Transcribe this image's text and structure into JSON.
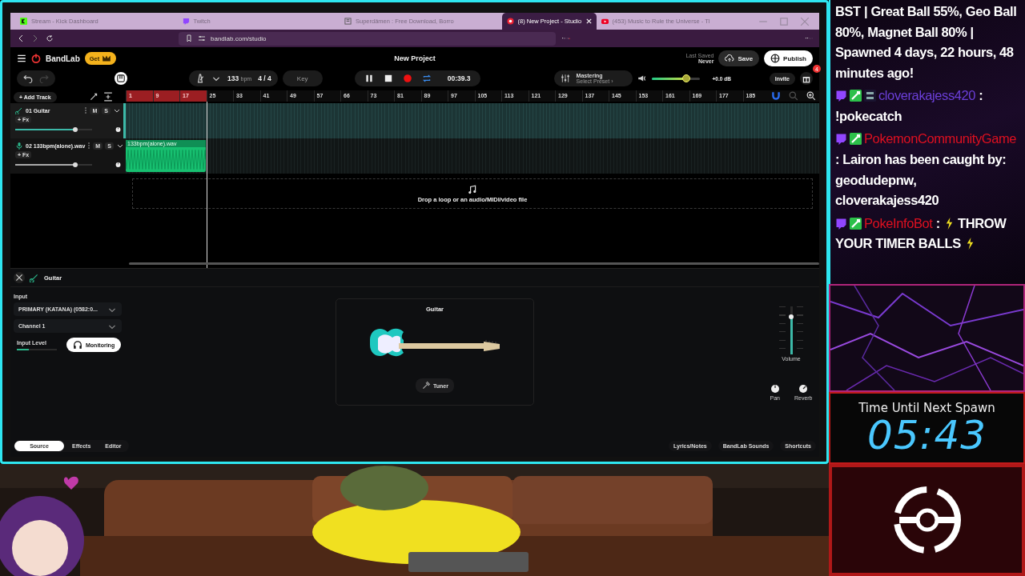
{
  "browser": {
    "tabs": [
      {
        "title": "Stream - Kick Dashboard",
        "selected": false
      },
      {
        "title": "Twitch",
        "selected": false
      },
      {
        "title": "Superdämen : Free Download, Borro",
        "selected": false
      },
      {
        "title": "(8) New Project - Studio",
        "selected": true
      },
      {
        "title": "(453) Music to Rule the Universe - Tl",
        "selected": false
      }
    ],
    "address": "bandlab.com/studio"
  },
  "app": {
    "logo": "BandLab",
    "get_button": "Get",
    "project_title": "New Project",
    "last_saved_label": "Last Saved",
    "last_saved_value": "Never",
    "save": "Save",
    "publish": "Publish",
    "tempo": "133",
    "tempo_unit": "bpm",
    "time_signature": "4 / 4",
    "key": "Key",
    "playing": true,
    "time": "00:39.3",
    "loop_on": true,
    "mastering": {
      "title": "Mastering",
      "preset": "Select Preset ›"
    },
    "master_volume": {
      "level": 0.72
    },
    "gain": "+0.0 dB",
    "invite": "Invite",
    "gift_badge": "4",
    "add_track": "+ Add Track",
    "ruler": [
      {
        "label": "1",
        "in_loop": true
      },
      {
        "label": "9",
        "in_loop": true
      },
      {
        "label": "17",
        "in_loop": true
      },
      {
        "label": "25",
        "in_loop": false
      },
      {
        "label": "33",
        "in_loop": false
      },
      {
        "label": "41",
        "in_loop": false
      },
      {
        "label": "49",
        "in_loop": false
      },
      {
        "label": "57",
        "in_loop": false
      },
      {
        "label": "66",
        "in_loop": false
      },
      {
        "label": "73",
        "in_loop": false
      },
      {
        "label": "81",
        "in_loop": false
      },
      {
        "label": "89",
        "in_loop": false
      },
      {
        "label": "97",
        "in_loop": false
      },
      {
        "label": "105",
        "in_loop": false
      },
      {
        "label": "113",
        "in_loop": false
      },
      {
        "label": "121",
        "in_loop": false
      },
      {
        "label": "129",
        "in_loop": false
      },
      {
        "label": "137",
        "in_loop": false
      },
      {
        "label": "145",
        "in_loop": false
      },
      {
        "label": "153",
        "in_loop": false
      },
      {
        "label": "161",
        "in_loop": false
      },
      {
        "label": "169",
        "in_loop": false
      },
      {
        "label": "177",
        "in_loop": false
      },
      {
        "label": "185",
        "in_loop": false
      }
    ],
    "tracks": [
      {
        "number": "01",
        "name": "Guitar",
        "kind": "instrument",
        "selected": true,
        "fx": "+ Fx",
        "mute": "M",
        "solo": "S",
        "volume": {
          "level": 0.78
        }
      },
      {
        "number": "02",
        "name": "133bpm(alone).wav",
        "kind": "audio",
        "selected": false,
        "fx": "+ Fx",
        "mute": "M",
        "solo": "S",
        "volume": {
          "level": 0.78
        },
        "clip": "133bpm(alone).wav"
      }
    ],
    "drop_hint": "Drop a loop or an audio/MIDI/video file",
    "editor": {
      "title": "Guitar",
      "input_label": "Input",
      "input_device": "PRIMARY (KATANA) (0582:0...",
      "channel": "Channel 1",
      "input_level": {
        "label": "Input Level",
        "level": 0.3
      },
      "monitoring": {
        "label": "Monitoring",
        "on": true
      },
      "instrument": "Guitar",
      "tuner": "Tuner",
      "volume": {
        "label": "Volume",
        "level": 0.78
      },
      "pan": "Pan",
      "reverb": "Reverb"
    },
    "footer": {
      "tabs": [
        {
          "label": "Source",
          "selected": true
        },
        {
          "label": "Effects",
          "selected": false
        },
        {
          "label": "Editor",
          "selected": false
        }
      ],
      "links": [
        "Lyrics/Notes",
        "BandLab Sounds",
        "Shortcuts"
      ]
    }
  },
  "chat": [
    {
      "segments": [
        {
          "kind": "text",
          "text": "BST | Great Ball 55%, Geo Ball 80%, Magnet Ball 80% | Spawned 4 days, 22 hours, 48 minutes ago!"
        }
      ]
    },
    {
      "badges": [
        {
          "kind": "twitch"
        },
        {
          "kind": "sword"
        },
        {
          "kind": "year"
        }
      ],
      "username": "cloverakajess420",
      "color": "#6b3fd8",
      "separator": ":",
      "segments": [
        {
          "kind": "text",
          "text": "!pokecatch"
        }
      ]
    },
    {
      "badges": [
        {
          "kind": "twitch"
        },
        {
          "kind": "sword"
        }
      ],
      "username": "PokemonCommunityGame",
      "color": "#e01020",
      "separator": ":",
      "segments": [
        {
          "kind": "text",
          "text": "Lairon has been caught by: geodudepnw, cloverakajess420"
        }
      ]
    },
    {
      "badges": [
        {
          "kind": "twitch"
        },
        {
          "kind": "sword"
        }
      ],
      "username": "PokeInfoBot",
      "color": "#e01020",
      "separator": ":",
      "segments": [
        {
          "kind": "bolt"
        },
        {
          "kind": "text",
          "text": "THROW YOUR TIMER BALLS"
        },
        {
          "kind": "bolt"
        }
      ]
    }
  ],
  "timer": {
    "title": "Time Until Next Spawn",
    "value": "05:43"
  }
}
